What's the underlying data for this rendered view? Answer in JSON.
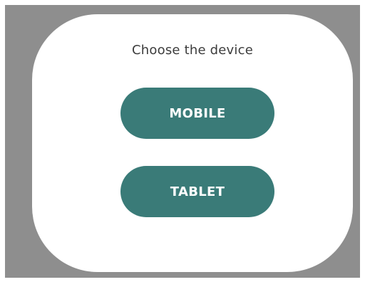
{
  "dialog": {
    "title": "Choose the device",
    "buttons": {
      "mobile_label": "MOBILE",
      "tablet_label": "TABLET"
    }
  },
  "colors": {
    "button_bg": "#3a7b78",
    "backdrop": "#8e8e8e",
    "dialog_bg": "#ffffff"
  }
}
